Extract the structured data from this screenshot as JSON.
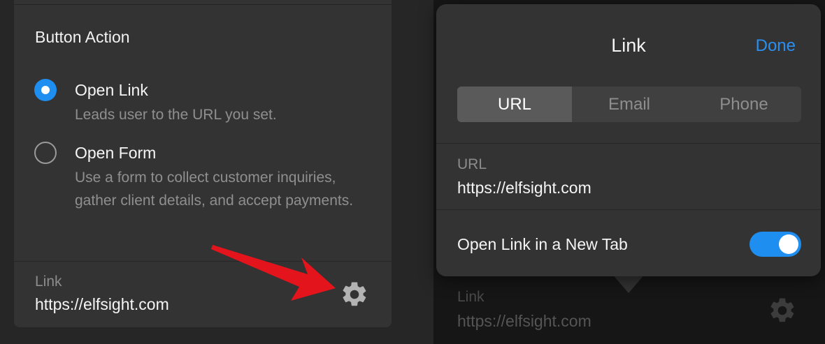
{
  "left": {
    "section_title": "Button Action",
    "options": [
      {
        "title": "Open Link",
        "description": "Leads user to the URL you set.",
        "selected": true
      },
      {
        "title": "Open Form",
        "description": "Use a form to collect customer inquiries, gather client details, and accept payments.",
        "selected": false
      }
    ],
    "link_label": "Link",
    "link_value": "https://elfsight.com",
    "gear_icon": "gear-icon",
    "annotation_arrow_color": "#e3141b"
  },
  "popover": {
    "title": "Link",
    "done_label": "Done",
    "segments": [
      "URL",
      "Email",
      "Phone"
    ],
    "active_segment": "URL",
    "url_label": "URL",
    "url_value": "https://elfsight.com",
    "new_tab_label": "Open Link in a New Tab",
    "new_tab_enabled": true,
    "accent_color": "#1e8ff0"
  },
  "behind": {
    "link_label": "Link",
    "link_value": "https://elfsight.com"
  }
}
